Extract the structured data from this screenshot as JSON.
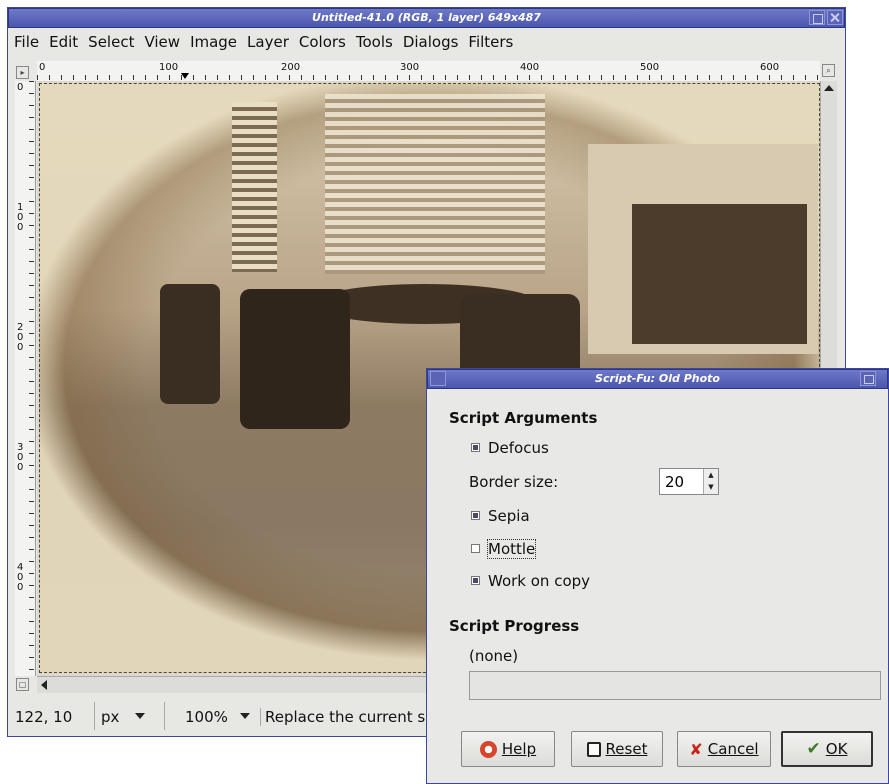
{
  "gimp": {
    "title": "Untitled-41.0 (RGB, 1 layer) 649x487",
    "menu": [
      "File",
      "Edit",
      "Select",
      "View",
      "Image",
      "Layer",
      "Colors",
      "Tools",
      "Dialogs",
      "Filters"
    ],
    "ruler_labels": [
      "0",
      "100",
      "200",
      "300",
      "400",
      "500",
      "600"
    ],
    "vruler_labels": [
      "0",
      "100",
      "200",
      "300",
      "400"
    ],
    "status": {
      "coords": "122, 10",
      "unit": "px",
      "zoom": "100%",
      "message": "Replace the current se"
    }
  },
  "dialog": {
    "title": "Script-Fu: Old Photo",
    "section_args": "Script Arguments",
    "defocus_label": "Defocus",
    "defocus_checked": true,
    "border_label": "Border size:",
    "border_value": "20",
    "sepia_label": "Sepia",
    "sepia_checked": true,
    "mottle_label": "Mottle",
    "mottle_checked": false,
    "work_on_copy_label": "Work on copy",
    "work_on_copy_checked": true,
    "section_progress": "Script Progress",
    "progress_text": "(none)",
    "buttons": {
      "help": "Help",
      "reset": "Reset",
      "cancel": "Cancel",
      "ok": "OK"
    }
  },
  "colors": {
    "titlebar": "#5661b5",
    "window_bg": "#e7e7e4",
    "sepia_light": "#e6dabe",
    "sepia_dark": "#8a7863"
  }
}
